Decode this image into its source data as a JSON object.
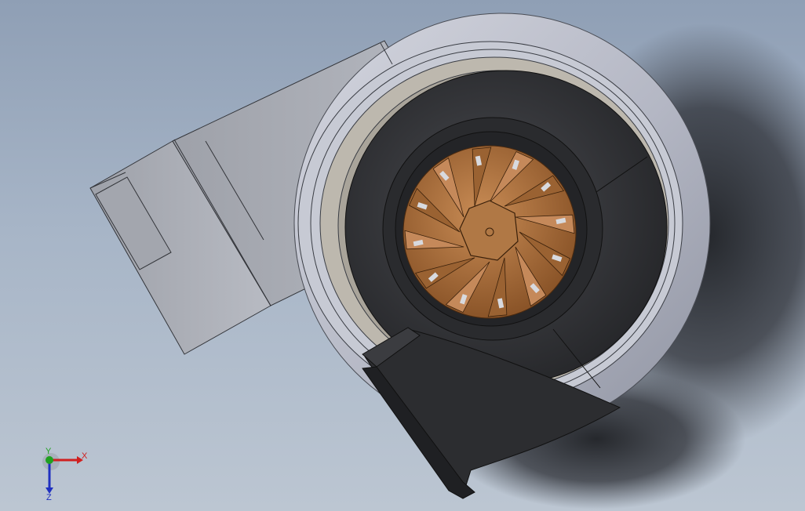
{
  "viewport": {
    "model": "turbocharger",
    "background_top": "#8f9fb5",
    "background_bottom": "#bcc6d2"
  },
  "colors": {
    "housing": "#b9bcc8",
    "housing_dark": "#6f7480",
    "inlet_pipe": "#a9acb4",
    "volute": "#2e2f32",
    "wheel": "#b07845",
    "wheel_dark": "#7a4a22",
    "shadow": "#2a2c30"
  },
  "triad": {
    "x_label": "X",
    "y_label": "Y",
    "z_label": "Z",
    "x_color": "#d02020",
    "y_color": "#20a020",
    "z_color": "#2030c0"
  }
}
